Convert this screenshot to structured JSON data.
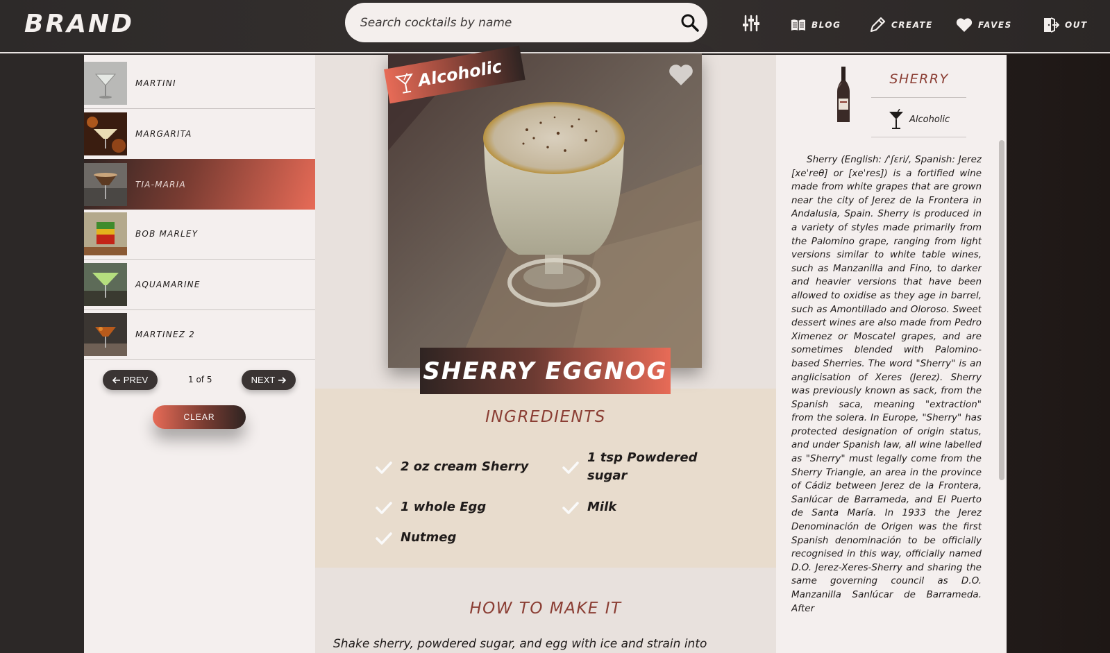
{
  "header": {
    "brand": "BRAND",
    "search_placeholder": "Search cocktails by name",
    "nav": [
      {
        "label": "",
        "icon": "filter-icon"
      },
      {
        "label": "BLOG",
        "icon": "book-icon"
      },
      {
        "label": "CREATE",
        "icon": "pencil-icon"
      },
      {
        "label": "FAVES",
        "icon": "heart-icon"
      },
      {
        "label": "OUT",
        "icon": "logout-icon"
      }
    ]
  },
  "sidebar": {
    "items": [
      {
        "label": "MARTINI"
      },
      {
        "label": "MARGARITA"
      },
      {
        "label": "TIA-MARIA",
        "active": true
      },
      {
        "label": "BOB MARLEY"
      },
      {
        "label": "AQUAMARINE"
      },
      {
        "label": "MARTINEZ 2"
      }
    ],
    "prev_label": "PREV",
    "next_label": "NEXT",
    "page_text": "1 of 5",
    "clear_label": "CLEAR"
  },
  "drink": {
    "badge": "Alcoholic",
    "title": "SHERRY EGGNOG",
    "ingredients_heading": "INGREDIENTS",
    "ingredients": [
      "2 oz cream Sherry",
      "1 tsp Powdered sugar",
      "1 whole Egg",
      "Milk",
      "Nutmeg"
    ],
    "howto_heading": "HOW TO MAKE IT",
    "instructions": "Shake sherry, powdered sugar, and egg with ice and strain into"
  },
  "ingredient_info": {
    "name": "SHERRY",
    "type": "Alcoholic",
    "description": "Sherry (English: /ˈʃɛri/, Spanish: Jerez [xeˈreθ] or [xeˈres]) is a fortified wine made from white grapes that are grown near the city of Jerez de la Frontera in Andalusia, Spain. Sherry is produced in a variety of styles made primarily from the Palomino grape, ranging from light versions similar to white table wines, such as Manzanilla and Fino, to darker and heavier versions that have been allowed to oxidise as they age in barrel, such as Amontillado and Oloroso. Sweet dessert wines are also made from Pedro Ximenez or Moscatel grapes, and are sometimes blended with Palomino-based Sherries. The word \"Sherry\" is an anglicisation of Xeres (Jerez). Sherry was previously known as sack, from the Spanish saca, meaning \"extraction\" from the solera. In Europe, \"Sherry\" has protected designation of origin status, and under Spanish law, all wine labelled as \"Sherry\" must legally come from the Sherry Triangle, an area in the province of Cádiz between Jerez de la Frontera, Sanlúcar de Barrameda, and El Puerto de Santa María. In 1933 the Jerez Denominación de Origen was the first Spanish denominación to be officially recognised in this way, officially named D.O. Jerez-Xeres-Sherry and sharing the same governing council as D.O. Manzanilla Sanlúcar de Barrameda. After"
  },
  "colors": {
    "accent": "#e76b57",
    "heading": "#8a3d33",
    "dark": "#2f2422"
  }
}
